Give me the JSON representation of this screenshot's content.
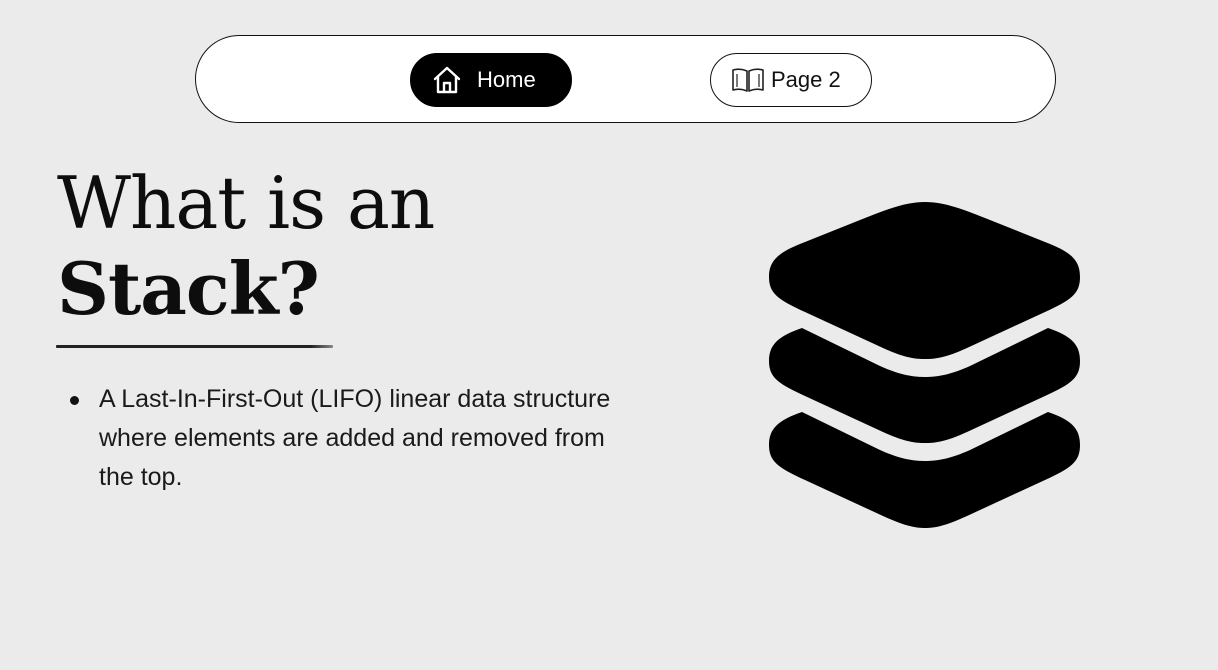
{
  "nav": {
    "home_label": "Home",
    "home_icon": "home-icon",
    "page2_label": "Page 2",
    "page2_icon": "open-book-icon"
  },
  "heading": {
    "line1": "What is an",
    "line2": "Stack?"
  },
  "bullets": [
    {
      "text": "A Last-In-First-Out (LIFO) linear data structure where elements are added and removed from the top."
    }
  ],
  "illustration": {
    "icon": "stack-layers-icon"
  },
  "colors": {
    "background": "#ebebeb",
    "active_button": "#000000",
    "nav_bar": "#ffffff"
  }
}
